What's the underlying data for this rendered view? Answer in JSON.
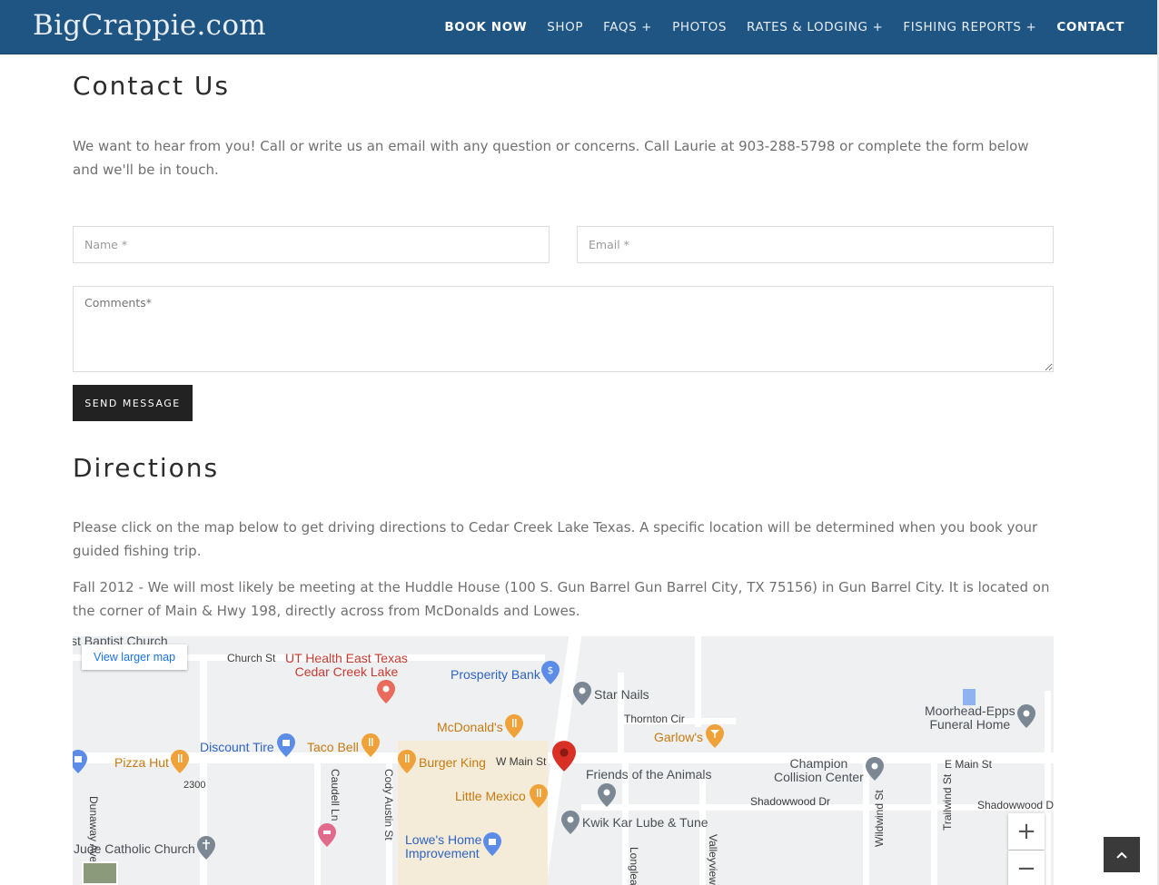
{
  "header": {
    "logo": "BigCrappie.com",
    "nav": [
      {
        "label": "BOOK NOW",
        "bold": true
      },
      {
        "label": "SHOP",
        "bold": false
      },
      {
        "label": "FAQS +",
        "bold": false
      },
      {
        "label": "PHOTOS",
        "bold": false
      },
      {
        "label": "RATES & LODGING +",
        "bold": false
      },
      {
        "label": "FISHING REPORTS +",
        "bold": false
      },
      {
        "label": "CONTACT",
        "bold": true
      }
    ]
  },
  "contact": {
    "title": "Contact Us",
    "intro": "We want to hear from you!  Call or write us an email with any question or concerns.  Call Laurie at 903-288-5798 or complete the form below and we'll be in touch.",
    "form": {
      "name_placeholder": "Name *",
      "email_placeholder": "Email *",
      "comments_placeholder": "Comments*",
      "submit_label": "SEND MESSAGE"
    }
  },
  "directions": {
    "title": "Directions",
    "para1": "Please click on the map below to get driving directions to Cedar Creek Lake Texas. A specific location will be determined when you book your guided fishing trip.",
    "para2": "Fall 2012 - We will most likely be meeting at the Huddle House (100 S. Gun Barrel Gun Barrel City, TX 75156) in Gun Barrel City. It is located on the corner of Main & Hwy 198, directly across from McDonalds and Lowes."
  },
  "map": {
    "larger_map": "View larger map",
    "roads": {
      "w_main": "W Main St",
      "e_main": "E Main St",
      "church": "Church St",
      "dunaway": "Dunaway Ave",
      "caudell": "Caudell Ln",
      "cody": "Cody Austin St",
      "thornton": "Thornton Cir",
      "shadowwood1": "Shadowwood Dr",
      "shadowwood2": "Shadowwood Dr",
      "wildwind": "Wildwind St",
      "trailwind": "Trailwind St",
      "hwy": "2300",
      "valleyview": "Valleyview",
      "longleaf": "Longlea"
    },
    "places": {
      "baptist": "st Baptist Church",
      "ut_health": "UT Health East Texas\nCedar Creek Lake",
      "prosperity": "Prosperity Bank",
      "star_nails": "Star Nails",
      "moorhead": "Moorhead-Epps\nFuneral Home",
      "mcdonalds": "McDonald's",
      "garlows": "Garlow's",
      "discount_tire": "Discount Tire",
      "taco_bell": "Taco Bell",
      "pizza_hut": "Pizza Hut",
      "burger_king": "Burger King",
      "champion": "Champion\nCollision Center",
      "friends": "Friends of the Animals",
      "little_mexico": "Little Mexico",
      "kwik_kar": "Kwik Kar Lube & Tune",
      "lowes": "Lowe's Home\nImprovement",
      "jude": "Jude Catholic Church"
    },
    "zoom_in": "+",
    "zoom_out": "−"
  },
  "colors": {
    "header_bg": "#1f5583",
    "button_bg": "#222222",
    "map_pin": "#d93025"
  }
}
